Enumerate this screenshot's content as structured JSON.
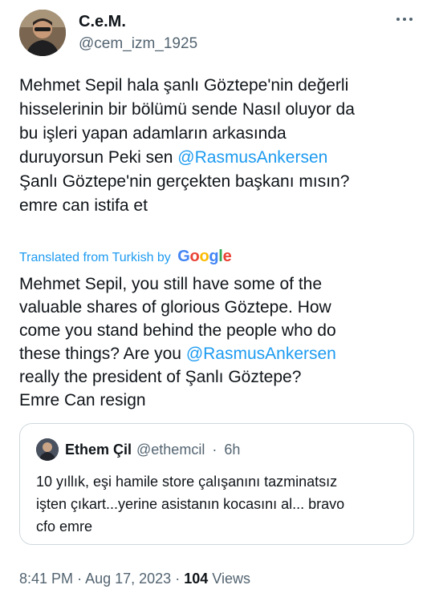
{
  "author": {
    "display_name": "C.e.M.",
    "handle": "@cem_izm_1925"
  },
  "menu_icon": "more-horizontal-icon",
  "tweet": {
    "original_lines": [
      {
        "text": "Mehmet Sepil hala şanlı Göztepe'nin değerli"
      },
      {
        "text": "hisselerinin bir bölümü sende Nasıl oluyor da"
      },
      {
        "text": "bu işleri yapan adamların arkasında"
      },
      {
        "prefix": "duruyorsun Peki sen ",
        "mention": "@RasmusAnkersen"
      },
      {
        "text": "Şanlı Göztepe'nin gerçekten başkanı mısın?"
      },
      {
        "text": "emre can istifa et"
      }
    ],
    "translated_label": "Translated from Turkish by",
    "translation_provider": "Google",
    "translation_lines": [
      {
        "text": "Mehmet Sepil, you still have some of the"
      },
      {
        "text": "valuable shares of glorious Göztepe. How"
      },
      {
        "text": "come you stand behind the people who do"
      },
      {
        "prefix": "these things? Are you ",
        "mention": "@RasmusAnkersen"
      },
      {
        "text": "really the president of Şanlı Göztepe?"
      },
      {
        "text": "Emre Can resign"
      }
    ]
  },
  "quoted_tweet": {
    "display_name": "Ethem Çil",
    "handle": "@ethemcil",
    "separator": "·",
    "time_ago": "6h",
    "lines": [
      "10 yıllık, eşi hamile store çalışanını tazminatsız",
      "işten çıkart...yerine asistanın kocasını al... bravo",
      "cfo emre"
    ]
  },
  "footer": {
    "time": "8:41 PM",
    "separator": "·",
    "date": "Aug 17, 2023",
    "separator2": "·",
    "views_count": "104",
    "views_label": "Views"
  },
  "colors": {
    "accent": "#1d9bf0",
    "text": "#0f1419",
    "muted": "#536471",
    "border": "#cfd9de"
  }
}
